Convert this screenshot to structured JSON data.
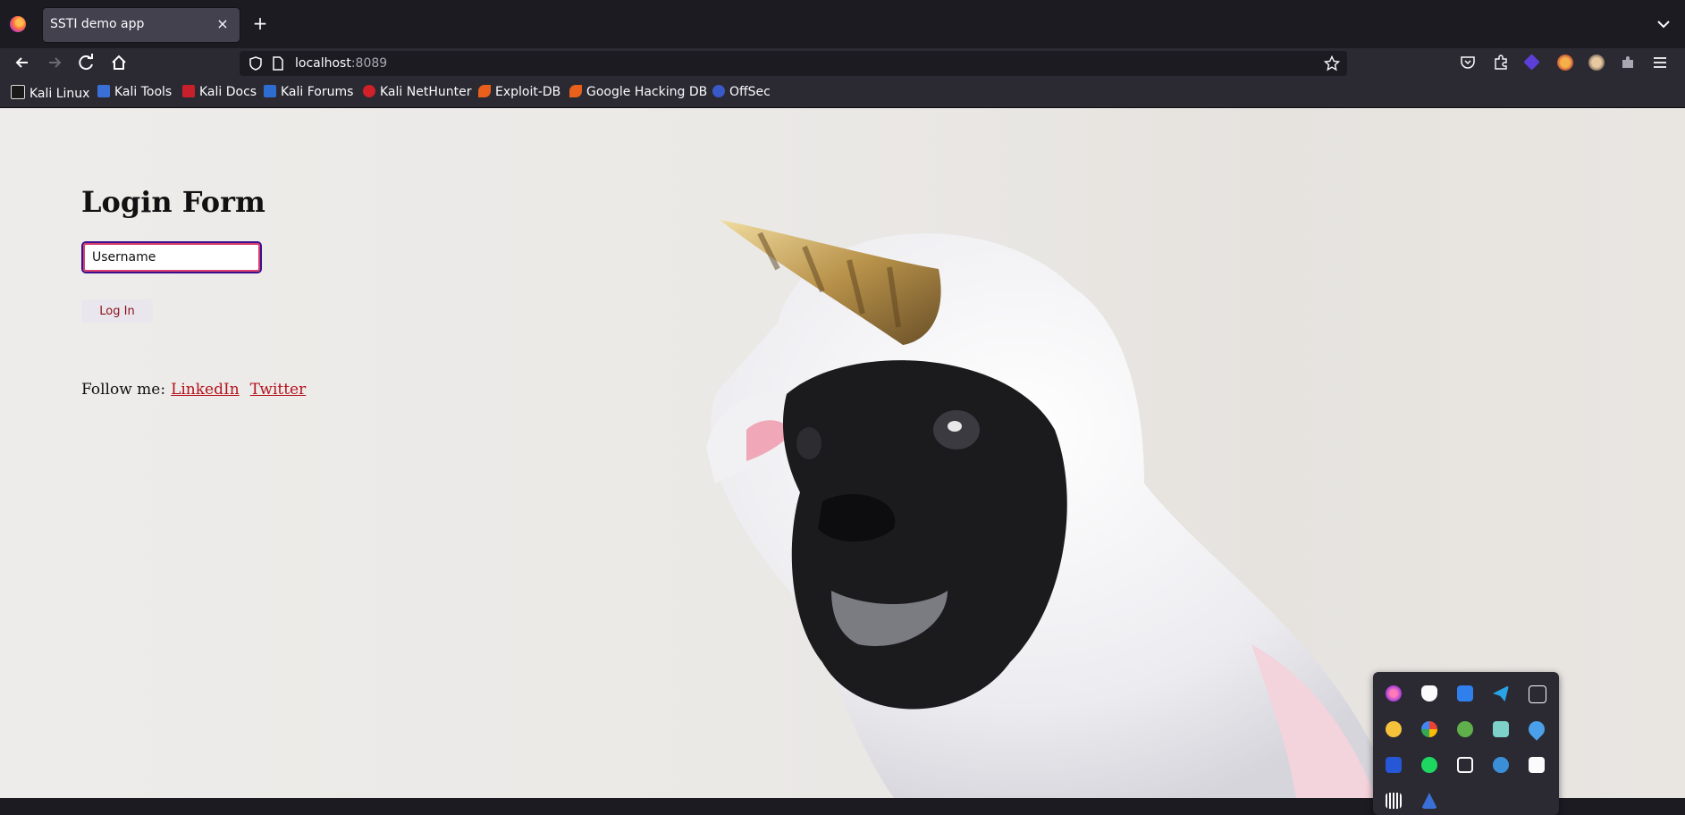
{
  "tab": {
    "title": "SSTI demo app",
    "close_glyph": "×",
    "new_tab_glyph": "+"
  },
  "urlbar": {
    "host": "localhost",
    "port": ":8089"
  },
  "bookmarks": [
    {
      "label": "Kali Linux",
      "icon": "kali-dragon-icon"
    },
    {
      "label": "Kali Tools",
      "icon": "kali-tools-icon"
    },
    {
      "label": "Kali Docs",
      "icon": "kali-docs-icon"
    },
    {
      "label": "Kali Forums",
      "icon": "kali-forums-icon"
    },
    {
      "label": "Kali NetHunter",
      "icon": "kali-nethunter-icon"
    },
    {
      "label": "Exploit-DB",
      "icon": "exploit-db-icon"
    },
    {
      "label": "Google Hacking DB",
      "icon": "ghdb-icon"
    },
    {
      "label": "OffSec",
      "icon": "offsec-icon"
    }
  ],
  "page": {
    "heading": "Login Form",
    "username_value": "Username",
    "login_button": "Log In",
    "follow_text": "Follow me:",
    "links": [
      "LinkedIn",
      "Twitter"
    ]
  },
  "colors": {
    "accent_link": "#b3121d",
    "focus_ring": "#3a0e8f"
  }
}
